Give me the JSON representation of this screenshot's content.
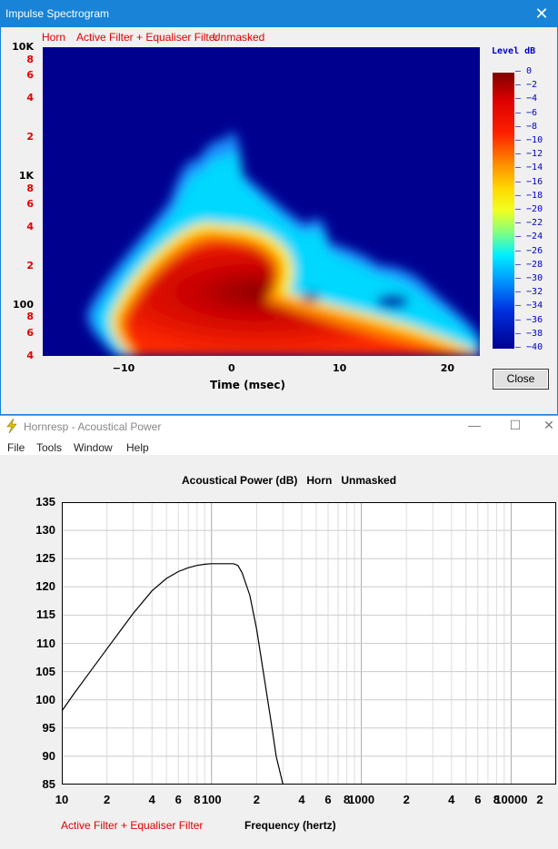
{
  "spectrogram_window": {
    "title": "Impulse Spectrogram",
    "labels": [
      "Horn",
      "Active Filter + Equaliser Filter",
      "Unmasked"
    ],
    "colorbar_header": "Level  dB",
    "close_label": "Close",
    "chart_data": {
      "type": "heatmap",
      "title": "",
      "xlabel": "Time (msec)",
      "ylabel": "",
      "x_range": [
        -17.5,
        23
      ],
      "y_range": [
        40,
        10000
      ],
      "y_scale": "log",
      "x_ticks": [
        "−10",
        "0",
        "10",
        "20"
      ],
      "y_ticks": [
        {
          "v": 10000,
          "label": "10K",
          "major": true
        },
        {
          "v": 8000,
          "label": "8",
          "major": false
        },
        {
          "v": 6000,
          "label": "6",
          "major": false
        },
        {
          "v": 4000,
          "label": "4",
          "major": false
        },
        {
          "v": 2000,
          "label": "2",
          "major": false
        },
        {
          "v": 1000,
          "label": "1K",
          "major": true
        },
        {
          "v": 800,
          "label": "8",
          "major": false
        },
        {
          "v": 600,
          "label": "6",
          "major": false
        },
        {
          "v": 400,
          "label": "4",
          "major": false
        },
        {
          "v": 200,
          "label": "2",
          "major": false
        },
        {
          "v": 100,
          "label": "100",
          "major": true
        },
        {
          "v": 80,
          "label": "8",
          "major": false
        },
        {
          "v": 60,
          "label": "6",
          "major": false
        },
        {
          "v": 40,
          "label": "4",
          "major": false
        }
      ],
      "colorbar_ticks": [
        "0",
        "−2",
        "−4",
        "−6",
        "−8",
        "−10",
        "−12",
        "−14",
        "−16",
        "−18",
        "−20",
        "−22",
        "−24",
        "−26",
        "−28",
        "−30",
        "−32",
        "−34",
        "−36",
        "−38",
        "−40"
      ],
      "level_range_db": [
        -40,
        0
      ]
    }
  },
  "power_window": {
    "title": "Hornresp - Acoustical Power",
    "menu": [
      "File",
      "Tools",
      "Window",
      "Help"
    ],
    "chart_title": "Acoustical Power (dB)   Horn   Unmasked",
    "footer_label": "Active Filter + Equaliser Filter",
    "chart_data": {
      "type": "line",
      "title": "Acoustical Power (dB)   Horn   Unmasked",
      "xlabel": "Frequency (hertz)",
      "ylabel": "",
      "x_scale": "log",
      "xlim": [
        10,
        20000
      ],
      "ylim": [
        85,
        135
      ],
      "grid": true,
      "y_ticks": [
        135,
        130,
        125,
        120,
        115,
        110,
        105,
        100,
        95,
        90,
        85
      ],
      "x_ticks": [
        {
          "v": 10,
          "label": "10"
        },
        {
          "v": 20,
          "label": "2"
        },
        {
          "v": 40,
          "label": "4"
        },
        {
          "v": 60,
          "label": "6"
        },
        {
          "v": 80,
          "label": "8"
        },
        {
          "v": 100,
          "label": "100"
        },
        {
          "v": 200,
          "label": "2"
        },
        {
          "v": 400,
          "label": "4"
        },
        {
          "v": 600,
          "label": "6"
        },
        {
          "v": 800,
          "label": "8"
        },
        {
          "v": 1000,
          "label": "1000"
        },
        {
          "v": 2000,
          "label": "2"
        },
        {
          "v": 4000,
          "label": "4"
        },
        {
          "v": 6000,
          "label": "6"
        },
        {
          "v": 8000,
          "label": "8"
        },
        {
          "v": 10000,
          "label": "10000"
        },
        {
          "v": 20000,
          "label": "2"
        }
      ],
      "series": [
        {
          "x": [
            10,
            12,
            15,
            20,
            25,
            30,
            40,
            50,
            60,
            70,
            80,
            90,
            100,
            120,
            140,
            150,
            160,
            180,
            200,
            220,
            250,
            270,
            300
          ],
          "y": [
            98,
            101,
            104.5,
            109,
            112.5,
            115.3,
            119.3,
            121.5,
            122.7,
            123.4,
            123.8,
            124,
            124.1,
            124.1,
            124.1,
            123.8,
            122.5,
            118.5,
            112.5,
            105.5,
            96,
            90,
            85
          ]
        }
      ]
    }
  }
}
